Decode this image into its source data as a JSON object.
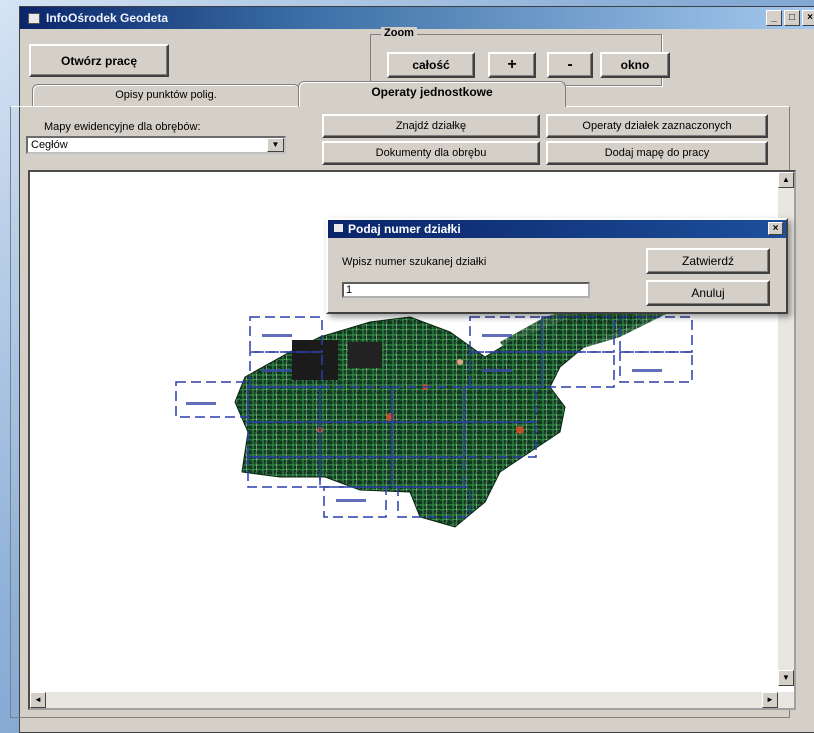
{
  "window": {
    "title": "InfoOśrodek Geodeta",
    "buttons": [
      "_",
      "□",
      "×"
    ]
  },
  "toolbar": {
    "open_label": "Otwórz pracę"
  },
  "zoom": {
    "legend": "Zoom",
    "buttons": {
      "all": "całość",
      "plus": "+",
      "minus": "-",
      "window": "okno"
    }
  },
  "tabs": [
    {
      "label": "Opisy punktów polig.",
      "active": false
    },
    {
      "label": "Operaty jednostkowe",
      "active": true
    }
  ],
  "panel": {
    "maps_label": "Mapy ewidencyjne dla obrębów:",
    "precinct_select": {
      "value": "Cegłów"
    },
    "buttons": {
      "find_parcel": "Znajdź działkę",
      "marked_parcels": "Operaty działek zaznaczonych",
      "precinct_docs": "Dokumenty dla obrębu",
      "add_map": "Dodaj mapę do pracy"
    }
  },
  "scroll_arrows": {
    "up": "▲",
    "down": "▼",
    "left": "◄",
    "right": "►",
    "dropdown": "▼"
  },
  "dialog": {
    "title": "Podaj numer działki",
    "close": "×",
    "prompt": "Wpisz numer szukanej działki",
    "input_value": "1",
    "confirm_label": "Zatwierdź",
    "cancel_label": "Anuluj"
  },
  "colors": {
    "title_active": "#0a246a",
    "window_bg": "#d4d0c8",
    "map_sheet_outline": "#2a3ea8",
    "map_parcels": "#0f3a1f"
  }
}
